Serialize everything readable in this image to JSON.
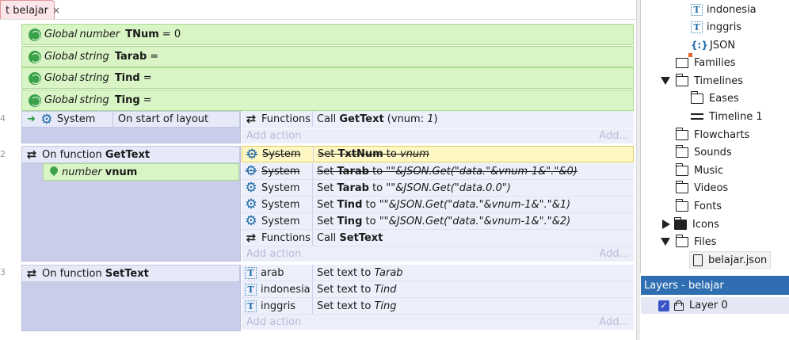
{
  "tab": {
    "title": "t belajar",
    "close": "×"
  },
  "globals": [
    {
      "scope": "Global",
      "type": "number",
      "name": "TNum",
      "suffix": "= 0"
    },
    {
      "scope": "Global",
      "type": "string",
      "name": "Tarab",
      "suffix": "="
    },
    {
      "scope": "Global",
      "type": "string",
      "name": "Tind",
      "suffix": "="
    },
    {
      "scope": "Global",
      "type": "string",
      "name": "Ting",
      "suffix": "="
    }
  ],
  "row_numbers": [
    "4",
    "2",
    "3"
  ],
  "event1": {
    "arrow": "➜",
    "cond_object": "System",
    "cond_text": "On start of layout",
    "action_object": "Functions",
    "action_pre": "Call ",
    "action_bold": "GetText",
    "action_args_a": " (vnum: ",
    "action_args_i": "1",
    "action_args_b": ")",
    "add_action": "Add action",
    "add_action_right": "Add..."
  },
  "event2": {
    "cond_pre": "On function ",
    "cond_bold": "GetText",
    "param_type": "number",
    "param_name": "vnum",
    "actions": [
      {
        "obj": "System",
        "pre": "Set ",
        "bold": "TxtNum",
        "mid": " to ",
        "ital": "vnum"
      },
      {
        "obj": "System",
        "pre": "Set ",
        "bold": "Tarab",
        "mid": " to ",
        "ital": "\"\"&JSON.Get(\"data.\"&vnum-1&\".\"&0)"
      },
      {
        "obj": "System",
        "pre": "Set ",
        "bold": "Tarab",
        "mid": " to ",
        "ital": "\"\"&JSON.Get(\"data.0.0\")"
      },
      {
        "obj": "System",
        "pre": "Set ",
        "bold": "Tind",
        "mid": " to ",
        "ital": "\"\"&JSON.Get(\"data.\"&vnum-1&\".\"&1)"
      },
      {
        "obj": "System",
        "pre": "Set ",
        "bold": "Ting",
        "mid": " to ",
        "ital": "\"\"&JSON.Get(\"data.\"&vnum-1&\".\"&2)"
      },
      {
        "obj": "Functions",
        "pre": "Call ",
        "bold": "SetText",
        "mid": "",
        "ital": ""
      }
    ],
    "add_action": "Add action",
    "add_action_right": "Add..."
  },
  "event3": {
    "cond_pre": "On function ",
    "cond_bold": "SetText",
    "actions": [
      {
        "obj": "arab",
        "pre": "Set text to ",
        "ital": "Tarab"
      },
      {
        "obj": "indonesia",
        "pre": "Set text to ",
        "ital": "Tind"
      },
      {
        "obj": "inggris",
        "pre": "Set text to ",
        "ital": "Ting"
      }
    ],
    "add_action": "Add action",
    "add_action_right": "Add..."
  },
  "project_tree": {
    "indonesia": "indonesia",
    "inggris": "inggris",
    "json": "JSON",
    "json_icon": "{:}",
    "families": "Families",
    "timelines": "Timelines",
    "eases": "Eases",
    "timeline1": "Timeline 1",
    "flowcharts": "Flowcharts",
    "sounds": "Sounds",
    "music": "Music",
    "videos": "Videos",
    "fonts": "Fonts",
    "icons": "Icons",
    "files": "Files",
    "belajar_json": "belajar.json"
  },
  "layers": {
    "title": "Layers - belajar",
    "layer0": "Layer 0",
    "check": "✓"
  }
}
